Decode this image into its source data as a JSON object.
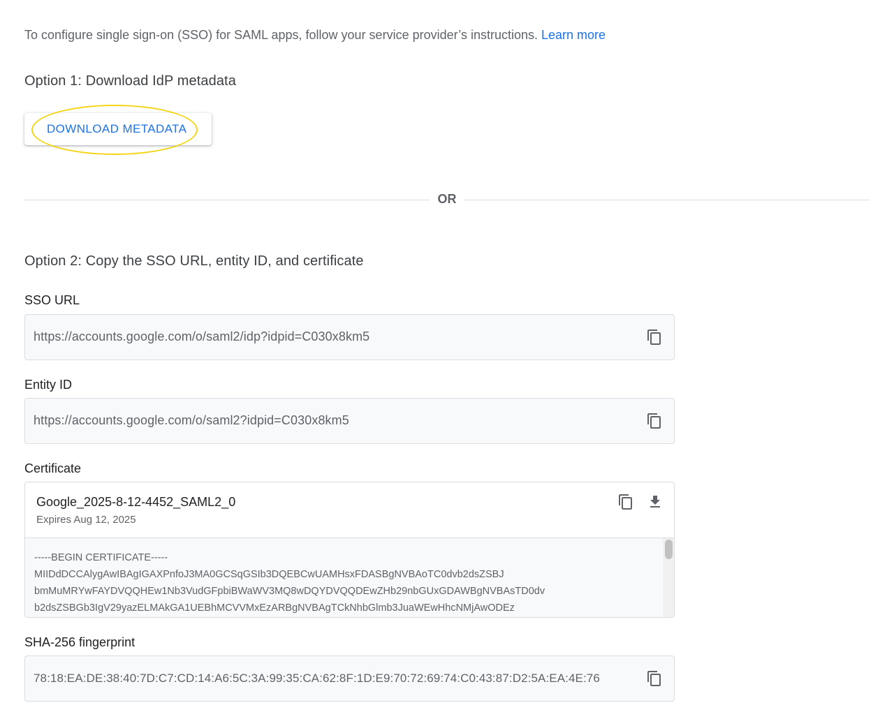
{
  "intro": {
    "text": "To configure single sign-on (SSO) for SAML apps, follow your service provider’s instructions.",
    "link": "Learn more"
  },
  "option1": {
    "heading": "Option 1: Download IdP metadata",
    "button_label": "DOWNLOAD METADATA"
  },
  "divider": {
    "label": "OR"
  },
  "option2": {
    "heading": "Option 2: Copy the SSO URL, entity ID, and certificate",
    "sso_url": {
      "label": "SSO URL",
      "value": "https://accounts.google.com/o/saml2/idp?idpid=C030x8km5"
    },
    "entity_id": {
      "label": "Entity ID",
      "value": "https://accounts.google.com/o/saml2?idpid=C030x8km5"
    },
    "certificate": {
      "label": "Certificate",
      "name": "Google_2025-8-12-4452_SAML2_0",
      "expires": "Expires Aug 12, 2025",
      "lines": [
        "-----BEGIN CERTIFICATE-----",
        "MIIDdDCCAlygAwIBAgIGAXPnfoJ3MA0GCSqGSIb3DQEBCwUAMHsxFDASBgNVBAoTC0dvb2dsZSBJ",
        "bmMuMRYwFAYDVQQHEw1Nb3VudGFpbiBWaWV3MQ8wDQYDVQQDEwZHb29nbGUxGDAWBgNVBAsTD0dv",
        "b2dsZSBGb3IgV29yazELMAkGA1UEBhMCVVMxEzARBgNVBAgTCkNhbGlmb3JuaWEwHhcNMjAwODEz"
      ]
    },
    "fingerprint": {
      "label": "SHA-256 fingerprint",
      "value": "78:18:EA:DE:38:40:7D:C7:CD:14:A6:5C:3A:99:35:CA:62:8F:1D:E9:70:72:69:74:C0:43:87:D2:5A:EA:4E:76"
    }
  },
  "icons": {
    "copy": "copy-icon",
    "download": "download-icon"
  },
  "colors": {
    "accent": "#1a73e8",
    "highlight": "#f4d516"
  }
}
